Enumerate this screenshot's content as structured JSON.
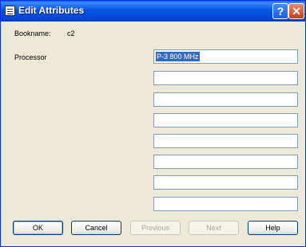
{
  "window": {
    "title": "Edit Attributes",
    "help_glyph": "?",
    "close_glyph": "✕"
  },
  "form": {
    "bookname_label": "Bookname:",
    "bookname_value": "c2",
    "processor_label": "Processor",
    "processor_value": "P-3 800 MHz"
  },
  "buttons": {
    "ok": "OK",
    "cancel": "Cancel",
    "previous": "Previous",
    "next": "Next",
    "help": "Help"
  }
}
